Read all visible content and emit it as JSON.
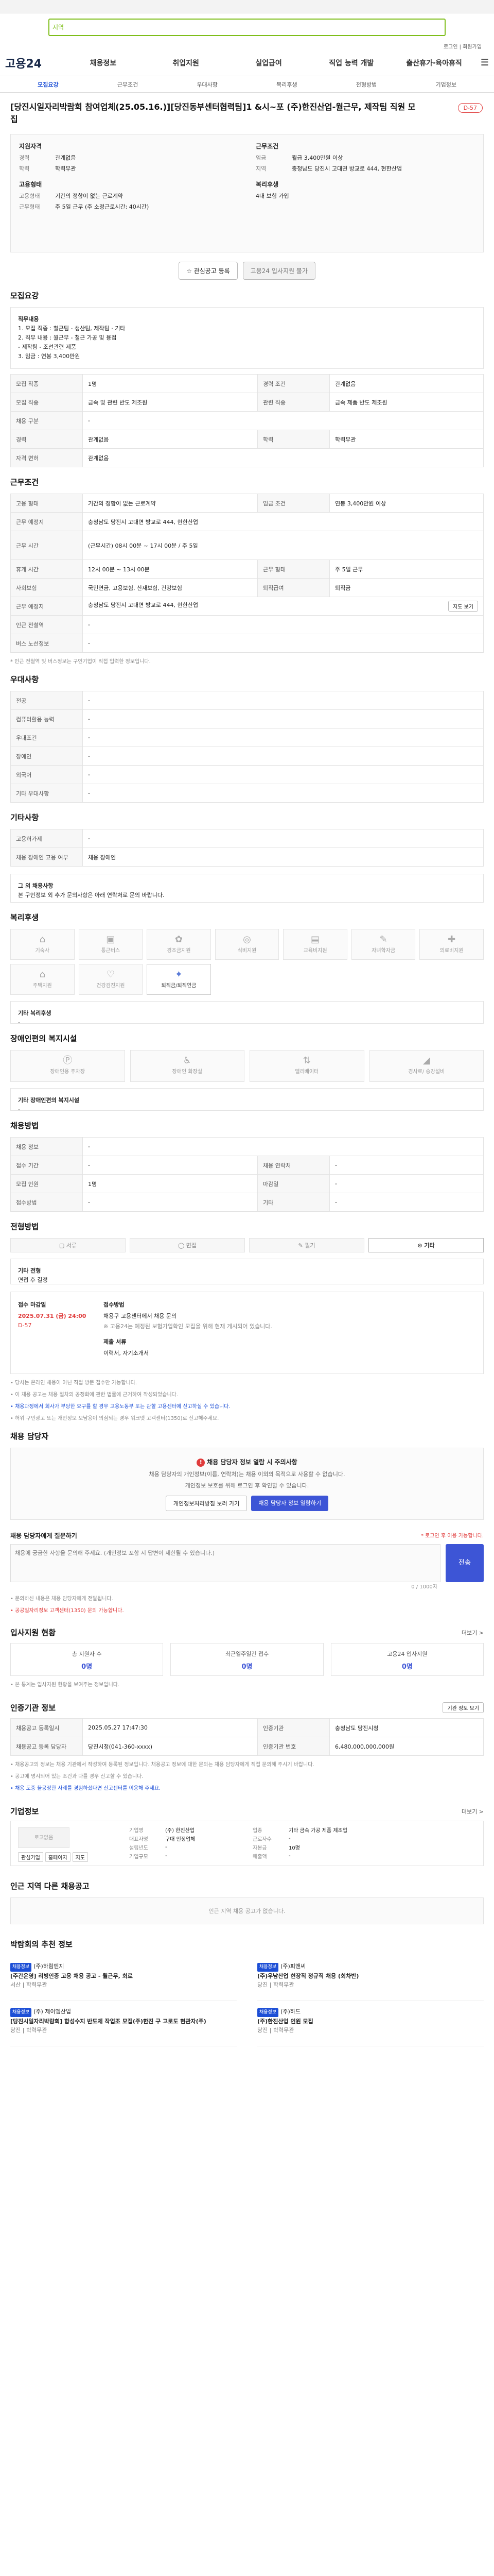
{
  "header": {
    "search_label": "지역",
    "util_links": "로그인 | 회원가입",
    "logo": "고용24",
    "nav": [
      "채용정보",
      "취업지원",
      "실업급여",
      "직업 능력 개발",
      "출산휴가·육아휴직"
    ],
    "menu_icon": "menu-icon"
  },
  "tabs": [
    "모집요강",
    "근무조건",
    "우대사항",
    "복리후생",
    "전형방법",
    "기업정보"
  ],
  "posting": {
    "title": "[당진시일자리박람회 참여업체(25.05.16.)][당진동부센터협력팀]1 &시~포 (주)한진산업-월근무, 제작팀 직원 모집",
    "dday": "D-57",
    "info": {
      "company_group": "지원자격",
      "career_label": "경력",
      "career_value": "관계없음",
      "edu_label": "학력",
      "edu_value": "학력무관",
      "work_group": "근무조건",
      "pay_label": "임금",
      "pay_value": "월급 3,400만원 이상",
      "loc_label": "지역",
      "loc_value": "충청남도 당진시 고대면 방교로 444, 현한산업",
      "type_group": "고용형태",
      "emp_label": "고용형태",
      "emp_value": "기간의 정함이 없는 근로계약",
      "hours_label": "근무형태",
      "hours_value": "주 5일 근무 (주 소정근로시간: 40시간)",
      "corp_group": "복리후생",
      "welfare_value": "4대 보험 가입"
    }
  },
  "buttons": {
    "scrap": "관심공고 등록",
    "share": "고용24 입사지원 불가"
  },
  "recruit": {
    "title": "모집요강",
    "duty_title": "직무내용",
    "duty_lines": [
      "1. 모집 직종 : 철근팀 - 생산팀, 제작팀 · 기타",
      "2. 직무 내용 : 월근무 - 철근 가공 및 용접",
      "            - 제작팀 - 조선관련 제품",
      "3. 임금 : 연봉 3,400만원"
    ],
    "rows": [
      [
        "모집 직종",
        "1명",
        "경력 조건",
        "관계없음"
      ],
      [
        "모집 직종",
        "금속 및 관련 반도 제조원",
        "관련 직종",
        "금속 제품 반도 제조원"
      ],
      [
        "채용 구분",
        "-",
        "",
        ""
      ],
      [
        "경력",
        "관계없음",
        "학력",
        "학력무관"
      ],
      [
        "자격 면허",
        "관계없음",
        "",
        ""
      ]
    ]
  },
  "conditions": {
    "title": "근무조건",
    "rows": [
      [
        "고용 형태",
        "기간의 정함이 없는 근로계약",
        "임금 조건",
        "연봉 3,400만원 이상"
      ],
      [
        "근무 예정지",
        "충청남도 당진시 고대면 방교로 444, 현한산업",
        "",
        ""
      ],
      [
        "근무 시간",
        "(근무시간) 08시 00분 ~ 17시 00분 / 주 5일",
        "",
        ""
      ],
      [
        "휴게 시간",
        "12시 00분 ~ 13시 00분",
        "근무 형태",
        "주 5일 근무"
      ],
      [
        "사회보험",
        "국민연금, 고용보험, 산재보험, 건강보험",
        "퇴직급여",
        "퇴직금"
      ],
      [
        "근무 예정지",
        "충청남도 당진시 고대면 방교로 444, 현한산업",
        "",
        ""
      ],
      [
        "인근 전철역",
        "-",
        "",
        ""
      ],
      [
        "버스 노선정보",
        "-",
        "",
        ""
      ]
    ],
    "map_button": "지도 보기",
    "note": "* 인근 전철역 및 버스정보는 구인기업이 직접 입력한 정보입니다."
  },
  "preference": {
    "title": "우대사항",
    "rows": [
      [
        "전공",
        "-"
      ],
      [
        "컴퓨터활용 능력",
        "-"
      ],
      [
        "우대조건",
        "-"
      ],
      [
        "장애인",
        "-"
      ],
      [
        "외국어",
        "-"
      ],
      [
        "기타 우대사항",
        "-"
      ]
    ]
  },
  "other": {
    "title": "기타사항",
    "rows": [
      [
        "고용허가제",
        "-"
      ],
      [
        "채용 장애인 고용 여부",
        "채용 장애인"
      ]
    ]
  },
  "other_note": {
    "head": "그 외 채용사항",
    "body": "본 구인정보 외 추가 문의사항은 아래 연락처로 문의 바랍니다."
  },
  "welfare": {
    "title": "복리후생",
    "items": [
      "기숙사",
      "통근버스",
      "경조금지원",
      "식비지원",
      "교육비지원",
      "자녀학자금",
      "의료비지원",
      "주택지원",
      "건강검진지원",
      "퇴직금/퇴직연금"
    ],
    "active_index": 9,
    "other_label": "기타 복리후생",
    "other_value": "-"
  },
  "disability": {
    "title": "장애인편의 복지시설",
    "items": [
      "장애인용 주차장",
      "장애인 화장실",
      "엘리베이터",
      "경사로/ 승강설비"
    ],
    "other_label": "기타 장애인편의 복지시설",
    "other_value": "-"
  },
  "apply": {
    "title": "채용방법",
    "rows": [
      [
        "채용 정보",
        "-"
      ],
      [
        "접수 기간",
        "-",
        "채용 연락처",
        "-"
      ],
      [
        "모집 인원",
        "1명",
        "마감일",
        "-"
      ],
      [
        "접수방법",
        "-",
        "기타",
        "-"
      ]
    ]
  },
  "process": {
    "title": "전형방법",
    "steps": [
      "서류",
      "면접",
      "필기",
      "기타"
    ],
    "active_index": 3,
    "detail_label": "기타 전형",
    "detail_value": "면접 후 결정"
  },
  "deadline": {
    "title": "마감일",
    "lcol_label": "접수 마감일",
    "deadline_date": "2025.07.31 (금) 24:00",
    "dday": "D-57",
    "r_label": "접수방법",
    "r_value": "채용구 고용센터에서 채용 문의",
    "r_value2": "※ 고용24는 예정된 보험가입확인 모집을 위해 현재 게시되어 있습니다.",
    "r_method_label": "제출 서류",
    "r_method_value": "이력서, 자기소개서",
    "notes": [
      "• 당사는 온라인 채용이 아닌 직접 방문 접수만 가능합니다.",
      "• 이 채용 공고는 채용 절차의 공정화에 관한 법률에 근거하여 작성되었습니다.",
      "• 채용과정에서 회사가 부당한 요구를 할 경우 고용노동부 또는 관할 고용센터에 신고하실 수 있습니다.",
      "• 허위 구인광고 또는 개인정보 오남용이 의심되는 경우 워크넷 고객센터(1350)로 신고해주세요."
    ]
  },
  "contact": {
    "title": "채용 담당자",
    "warn": "채용 담당자 정보 열람 시 주의사항",
    "line1": "채용 담당자의 개인정보(이름, 연락처)는 채용 이외의 목적으로 사용할 수 없습니다.",
    "line2": "개인정보 보호를 위해 로그인 후 확인할 수 있습니다.",
    "btn_a": "개인정보처리방침 보러 가기",
    "btn_b": "채용 담당자 정보 열람하기"
  },
  "inquiry": {
    "label": "채용 담당자에게 질문하기",
    "hint": "* 로그인 후 이용 가능합니다.",
    "placeholder": "채용에 궁금한 사항을 문의해 주세요. (개인정보 포함 시 답변이 제한될 수 있습니다.)",
    "count": "0 / 1000자",
    "send": "전송",
    "note1": "• 문의하신 내용은 채용 담당자에게 전달됩니다.",
    "note2": "• 공공일자리정보 고객센터(1350) 문의 가능합니다."
  },
  "stats": {
    "title": "입사지원 현황",
    "more": "더보기 >",
    "items": [
      [
        "총 지원자 수",
        "0명"
      ],
      [
        "최근일주일간 접수",
        "0명"
      ],
      [
        "고용24 입사지원",
        "0명"
      ]
    ],
    "note": "• 본 통계는 입사지원 현황을 보여주는 정보입니다."
  },
  "office": {
    "title": "인증기관 정보",
    "button": "기관 정보 보기",
    "rows": [
      [
        "채용공고 등록일시",
        "2025.05.27 17:47:30",
        "인증기관",
        "충청남도 당진시청"
      ],
      [
        "채용공고 등록 담당자",
        "당진시청(041-360-xxxx)",
        "인증기관 번호",
        "6,480,000,000,000원"
      ]
    ],
    "notes": [
      "• 채용공고의 정보는 채용 기관에서 작성하여 등록된 정보입니다. 채용공고 정보에 대한 문의는 채용 담당자에게 직접 문의해 주시기 바랍니다.",
      "• 공고에 명시되어 있는 조건과 다를 경우 신고할 수 있습니다.",
      "• 채용 도중 불공정한 사례를 경험하셨다면 신고센터를 이용해 주세요."
    ]
  },
  "company": {
    "title": "기업정보",
    "more": "더보기 >",
    "logo_alt": "로고없음",
    "actions": [
      "관심기업",
      "홈페이지",
      "지도"
    ],
    "rows": [
      [
        "기업명",
        "(주) 한진산업",
        "업종",
        "기타 금속 가공 제품 제조업"
      ],
      [
        "대표자명",
        "구대 인정업체",
        "근로자수",
        "-"
      ],
      [
        "설립년도",
        "-",
        "자본금",
        "10명"
      ],
      [
        "기업규모",
        "-",
        "매출액",
        "-"
      ]
    ]
  },
  "similar": {
    "title": "인근 지역 다른 채용공고",
    "empty": "인근 지역 채용 공고가 없습니다."
  },
  "related": {
    "title": "박람회의 추천 정보",
    "items": [
      {
        "tag": "채용정보",
        "company": "(주)하림엔지",
        "title": "[주간운영] 리빙인증 고용 채용 공고 - 월근무, 회로",
        "meta": "서산 | 학력무관"
      },
      {
        "tag": "채용정보",
        "company": "(주)피앤씨",
        "title": "(주)우남산업 현장직 정규직 채용 (회차반)",
        "meta": "당진 | 학력무관"
      },
      {
        "tag": "채용정보",
        "company": "(주) 제이엠산업",
        "title": "[당진시일자리박람회] 합성수지 반도체 작업조 모집(주)한진 구 고로도 현관자(주)",
        "meta": "당진 | 학력무관"
      },
      {
        "tag": "채용정보",
        "company": "(주)하드",
        "title": "(주)한진산업 인원 모집",
        "meta": "당진 | 학력무관"
      }
    ]
  }
}
